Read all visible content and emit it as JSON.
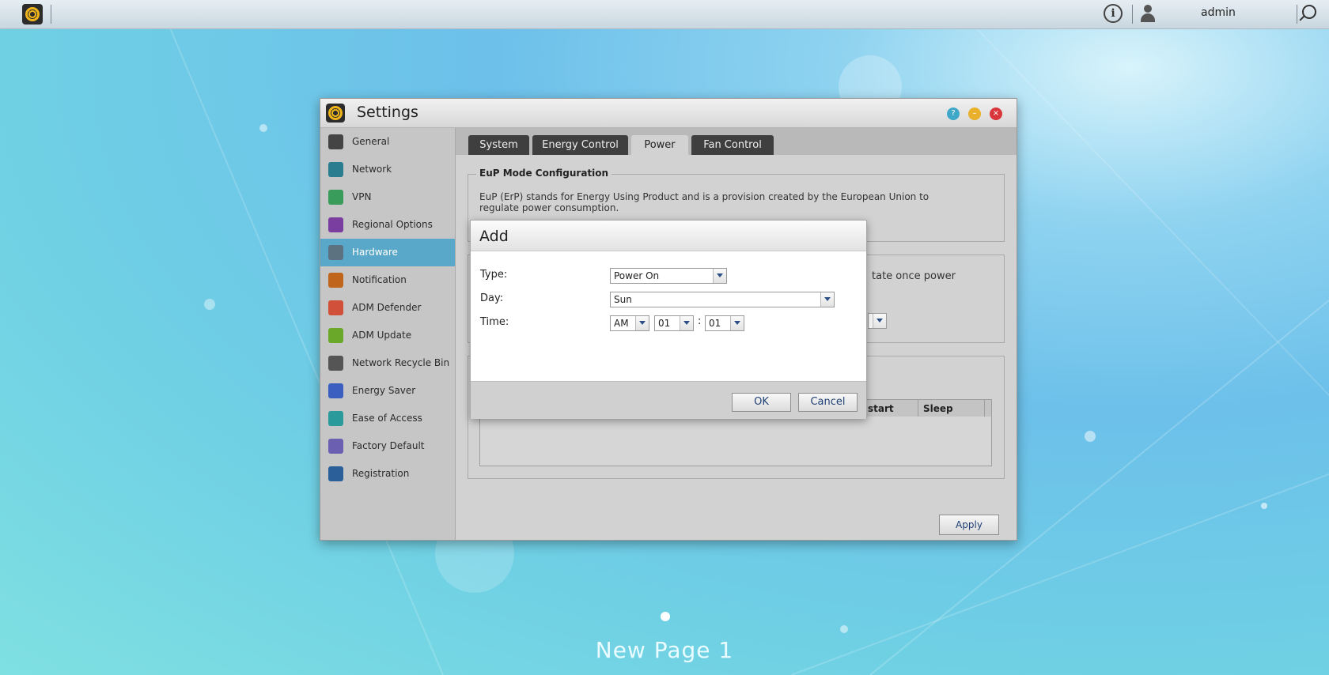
{
  "topbar": {
    "user_name": "admin"
  },
  "settings_window": {
    "title": "Settings",
    "sidebar": [
      {
        "label": "General",
        "icon": "server-icon",
        "color": "#444444",
        "active": false
      },
      {
        "label": "Network",
        "icon": "globe-icon",
        "color": "#2a7d8f",
        "active": false
      },
      {
        "label": "VPN",
        "icon": "house-icon",
        "color": "#3a9c5a",
        "active": false
      },
      {
        "label": "Regional Options",
        "icon": "map-pin-icon",
        "color": "#7a3da0",
        "active": false
      },
      {
        "label": "Hardware",
        "icon": "hardware-icon",
        "color": "#5c7280",
        "active": true
      },
      {
        "label": "Notification",
        "icon": "alert-icon",
        "color": "#c0661c",
        "active": false
      },
      {
        "label": "ADM Defender",
        "icon": "firewall-icon",
        "color": "#d0503a",
        "active": false
      },
      {
        "label": "ADM Update",
        "icon": "arrow-up-icon",
        "color": "#6aa82a",
        "active": false
      },
      {
        "label": "Network Recycle Bin",
        "icon": "trash-icon",
        "color": "#555555",
        "active": false
      },
      {
        "label": "Energy Saver",
        "icon": "lightning-icon",
        "color": "#3a5fc0",
        "active": false
      },
      {
        "label": "Ease of Access",
        "icon": "cloud-icon",
        "color": "#2a9a9a",
        "active": false
      },
      {
        "label": "Factory Default",
        "icon": "undo-icon",
        "color": "#6a5fb0",
        "active": false
      },
      {
        "label": "Registration",
        "icon": "clipboard-icon",
        "color": "#2a5f9a",
        "active": false
      }
    ],
    "tabs": [
      {
        "label": "System",
        "active": false
      },
      {
        "label": "Energy Control",
        "active": false
      },
      {
        "label": "Power",
        "active": true
      },
      {
        "label": "Fan Control",
        "active": false
      }
    ],
    "eup": {
      "legend": "EuP Mode Configuration",
      "description_line1": "EuP (ErP) stands for Energy Using Product and is a provision created by the European Union to",
      "description_line2": "regulate power consumption."
    },
    "power_state_partial": "tate once power",
    "schedule_table": {
      "headers_visible": [
        "start",
        "Sleep"
      ]
    },
    "apply_label": "Apply"
  },
  "add_dialog": {
    "title": "Add",
    "type_label": "Type:",
    "type_value": "Power On",
    "day_label": "Day:",
    "day_value": "Sun",
    "time_label": "Time:",
    "time_ampm": "AM",
    "time_hour": "01",
    "time_sep": ":",
    "time_minute": "01",
    "ok_label": "OK",
    "cancel_label": "Cancel"
  },
  "desktop": {
    "page_label": "New Page 1"
  }
}
